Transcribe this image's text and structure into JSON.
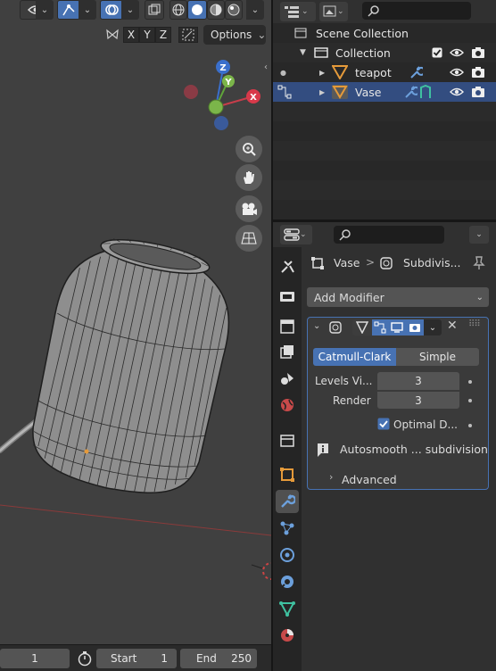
{
  "viewport": {
    "axis_buttons": [
      "X",
      "Y",
      "Z"
    ],
    "options_label": "Options",
    "gizmo": {
      "z": "Z",
      "y": "Y",
      "x": "X"
    }
  },
  "timeline": {
    "current_frame": "1",
    "start_label": "Start",
    "start_value": "1",
    "end_label": "End",
    "end_value": "250"
  },
  "outliner": {
    "scene_collection": "Scene Collection",
    "collection": "Collection",
    "objects": [
      {
        "name": "teapot"
      },
      {
        "name": "Vase"
      }
    ]
  },
  "properties": {
    "breadcrumb_object": "Vase",
    "breadcrumb_separator": ">",
    "breadcrumb_modifier": "Subdivis...",
    "add_modifier_label": "Add Modifier",
    "modifier": {
      "mode_options": [
        "Catmull-Clark",
        "Simple"
      ],
      "selected_mode": "Catmull-Clark",
      "levels_viewport_label": "Levels Vi...",
      "levels_viewport_value": "3",
      "render_label": "Render",
      "render_value": "3",
      "optimal_display_label": "Optimal D...",
      "optimal_display_checked": true,
      "info_text": "Autosmooth ... subdivision",
      "advanced_label": "Advanced"
    }
  },
  "colors": {
    "accent": "#4772b3",
    "outliner_selected": "#334d80",
    "object_orange": "#e59a3a",
    "modifier_blue": "#6ca0dc"
  }
}
